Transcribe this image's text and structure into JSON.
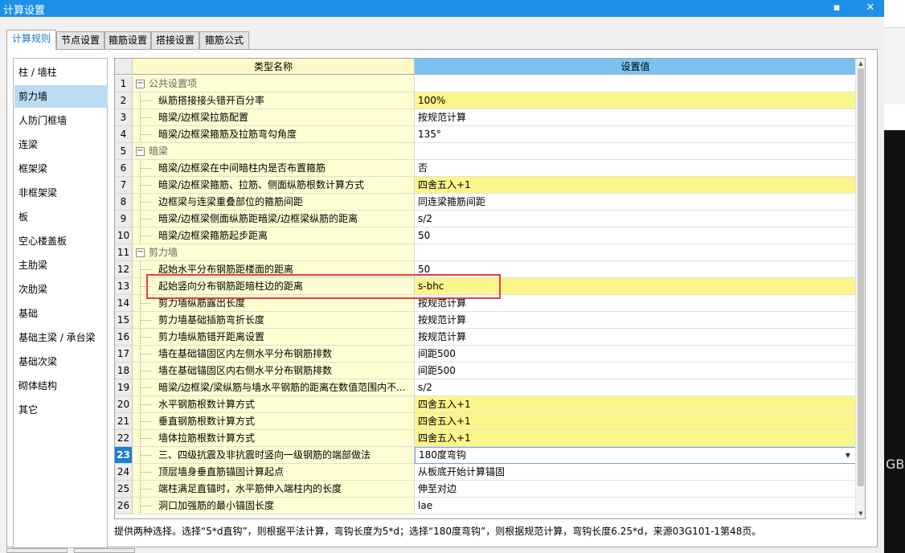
{
  "window": {
    "title": "计算设置",
    "minimize": "▪",
    "close": "✕"
  },
  "tabs": [
    "计算规则",
    "节点设置",
    "箍筋设置",
    "搭接设置",
    "箍筋公式"
  ],
  "categories": [
    "柱 / 墙柱",
    "剪力墙",
    "人防门框墙",
    "连梁",
    "框架梁",
    "非框架梁",
    "板",
    "空心楼盖板",
    "主肋梁",
    "次肋梁",
    "基础",
    "基础主梁 / 承台梁",
    "基础次梁",
    "砌体结构",
    "其它"
  ],
  "grid": {
    "headers": {
      "name": "类型名称",
      "value": "设置值"
    },
    "rows": [
      {
        "n": "1",
        "name": "公共设置项",
        "value": "",
        "group": true
      },
      {
        "n": "2",
        "name": "纵筋搭接接头错开百分率",
        "value": "100%",
        "hl": true
      },
      {
        "n": "3",
        "name": "暗梁/边框梁拉筋配置",
        "value": "按规范计算"
      },
      {
        "n": "4",
        "name": "暗梁/边框梁箍筋及拉筋弯勾角度",
        "value": "135°"
      },
      {
        "n": "5",
        "name": "暗梁",
        "value": "",
        "group": true
      },
      {
        "n": "6",
        "name": "暗梁/边框梁在中间暗柱内是否布置箍筋",
        "value": "否"
      },
      {
        "n": "7",
        "name": "暗梁/边框梁箍筋、拉筋、侧面纵筋根数计算方式",
        "value": "四舍五入+1",
        "hl": true
      },
      {
        "n": "8",
        "name": "边框梁与连梁重叠部位的箍筋间距",
        "value": "同连梁箍筋间距"
      },
      {
        "n": "9",
        "name": "暗梁/边框梁侧面纵筋距暗梁/边框梁纵筋的距离",
        "value": "s/2"
      },
      {
        "n": "10",
        "name": "暗梁/边框梁箍筋起步距离",
        "value": "50"
      },
      {
        "n": "11",
        "name": "剪力墙",
        "value": "",
        "group": true
      },
      {
        "n": "12",
        "name": "起始水平分布钢筋距楼面的距离",
        "value": "50"
      },
      {
        "n": "13",
        "name": "起始竖向分布钢筋距暗柱边的距离",
        "value": "s-bhc",
        "hl": true
      },
      {
        "n": "14",
        "name": "剪力墙纵筋露出长度",
        "value": "按规范计算"
      },
      {
        "n": "15",
        "name": "剪力墙基础插筋弯折长度",
        "value": "按规范计算"
      },
      {
        "n": "16",
        "name": "剪力墙纵筋错开距离设置",
        "value": "按规范计算"
      },
      {
        "n": "17",
        "name": "墙在基础锚固区内左侧水平分布钢筋排数",
        "value": "间距500"
      },
      {
        "n": "18",
        "name": "墙在基础锚固区内右侧水平分布钢筋排数",
        "value": "间距500"
      },
      {
        "n": "19",
        "name": "暗梁/边框梁/梁纵筋与墙水平钢筋的距离在数值范围内不...",
        "value": "s/2"
      },
      {
        "n": "20",
        "name": "水平钢筋根数计算方式",
        "value": "四舍五入+1",
        "hl": true
      },
      {
        "n": "21",
        "name": "垂直钢筋根数计算方式",
        "value": "四舍五入+1",
        "hl": true
      },
      {
        "n": "22",
        "name": "墙体拉筋根数计算方式",
        "value": "四舍五入+1",
        "hl": true
      },
      {
        "n": "23",
        "name": "三、四级抗震及非抗震时竖向一级钢筋的端部做法",
        "value": "180度弯钩",
        "current": true
      },
      {
        "n": "24",
        "name": "顶层墙身垂直筋锚固计算起点",
        "value": "从板底开始计算锚固"
      },
      {
        "n": "25",
        "name": "端柱满足直锚时，水平筋伸入端柱内的长度",
        "value": "伸至对边"
      },
      {
        "n": "26",
        "name": "洞口加强筋的最小锚固长度",
        "value": "lae"
      }
    ]
  },
  "hint": "提供两种选择。选择“5*d直钩”，则根据平法计算，弯钩长度为5*d；选择“180度弯钩”，则根据规范计算，弯钩长度6.25*d，来源03G101-1第48页。",
  "background": {
    "edge_text": "GB"
  },
  "colors": {
    "titlebar": "#1e90e8",
    "header": "#79c2f2",
    "highlight": "#fbf68c",
    "name_col": "#fffed2",
    "current_row": "#1f7ed6",
    "annotation_box": "#e8403a"
  }
}
